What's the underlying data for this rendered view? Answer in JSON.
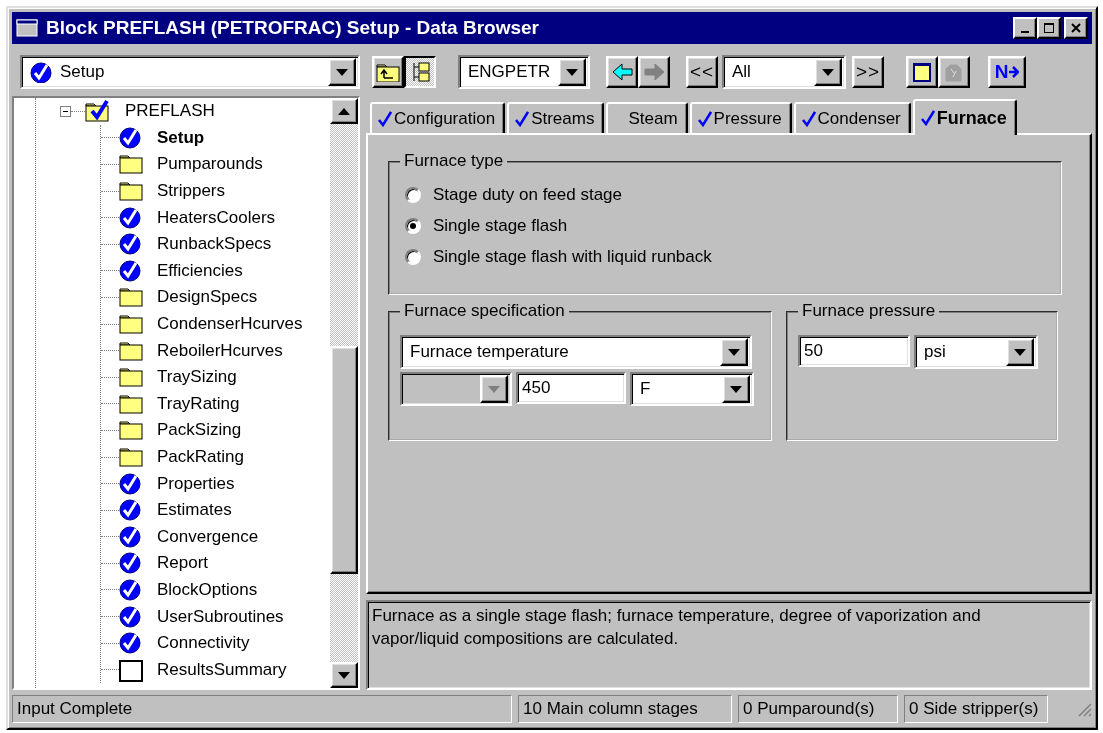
{
  "window": {
    "title": "Block PREFLASH (PETROFRAC) Setup - Data Browser"
  },
  "toolbar": {
    "form": "Setup",
    "tree_view_pressed": true,
    "units": "ENGPETR",
    "back_disabled": false,
    "forward_disabled": true,
    "previous": "<<",
    "filter": "All",
    "next": ">>",
    "status_disabled": true,
    "next_form": "N"
  },
  "tree": {
    "items": [
      {
        "label": "PREFLASH",
        "kind": "folder-complete",
        "expanded": true,
        "selected": false,
        "children": [
          {
            "label": "Setup",
            "kind": "complete",
            "selected": true
          },
          {
            "label": "Pumparounds",
            "kind": "folder",
            "selected": false
          },
          {
            "label": "Strippers",
            "kind": "folder",
            "selected": false
          },
          {
            "label": "HeatersCoolers",
            "kind": "complete",
            "selected": false
          },
          {
            "label": "RunbackSpecs",
            "kind": "complete",
            "selected": false
          },
          {
            "label": "Efficiencies",
            "kind": "complete",
            "selected": false
          },
          {
            "label": "DesignSpecs",
            "kind": "folder",
            "selected": false
          },
          {
            "label": "CondenserHcurves",
            "kind": "folder",
            "selected": false
          },
          {
            "label": "ReboilerHcurves",
            "kind": "folder",
            "selected": false
          },
          {
            "label": "TraySizing",
            "kind": "folder",
            "selected": false
          },
          {
            "label": "TrayRating",
            "kind": "folder",
            "selected": false
          },
          {
            "label": "PackSizing",
            "kind": "folder",
            "selected": false
          },
          {
            "label": "PackRating",
            "kind": "folder",
            "selected": false
          },
          {
            "label": "Properties",
            "kind": "complete",
            "selected": false
          },
          {
            "label": "Estimates",
            "kind": "complete",
            "selected": false
          },
          {
            "label": "Convergence",
            "kind": "complete",
            "selected": false
          },
          {
            "label": "Report",
            "kind": "complete",
            "selected": false
          },
          {
            "label": "BlockOptions",
            "kind": "complete",
            "selected": false
          },
          {
            "label": "UserSubroutines",
            "kind": "complete",
            "selected": false
          },
          {
            "label": "Connectivity",
            "kind": "complete",
            "selected": false
          },
          {
            "label": "ResultsSummary",
            "kind": "empty",
            "selected": false
          }
        ]
      }
    ]
  },
  "tabs": [
    {
      "label": "Configuration",
      "complete": true,
      "selected": false
    },
    {
      "label": "Streams",
      "complete": true,
      "selected": false
    },
    {
      "label": "Steam",
      "complete": false,
      "selected": false
    },
    {
      "label": "Pressure",
      "complete": true,
      "selected": false
    },
    {
      "label": "Condenser",
      "complete": true,
      "selected": false
    },
    {
      "label": "Furnace",
      "complete": true,
      "selected": true
    }
  ],
  "furnace_type": {
    "legend": "Furnace type",
    "options": [
      {
        "label": "Stage duty on feed stage",
        "selected": false
      },
      {
        "label": "Single stage flash",
        "selected": true
      },
      {
        "label": "Single stage flash with liquid runback",
        "selected": false
      }
    ]
  },
  "furnace_specification": {
    "legend": "Furnace specification",
    "type": "Furnace temperature",
    "qualifier_disabled": true,
    "value": "450",
    "unit": "F"
  },
  "furnace_pressure": {
    "legend": "Furnace pressure",
    "value": "50",
    "unit": "psi"
  },
  "description": "Furnace as a single stage flash; furnace temperature, degree of vaporization and vapor/liquid compositions are calculated.",
  "status_bar": [
    "Input Complete",
    "10 Main column stages",
    "0 Pumparound(s)",
    "0 Side stripper(s)"
  ]
}
